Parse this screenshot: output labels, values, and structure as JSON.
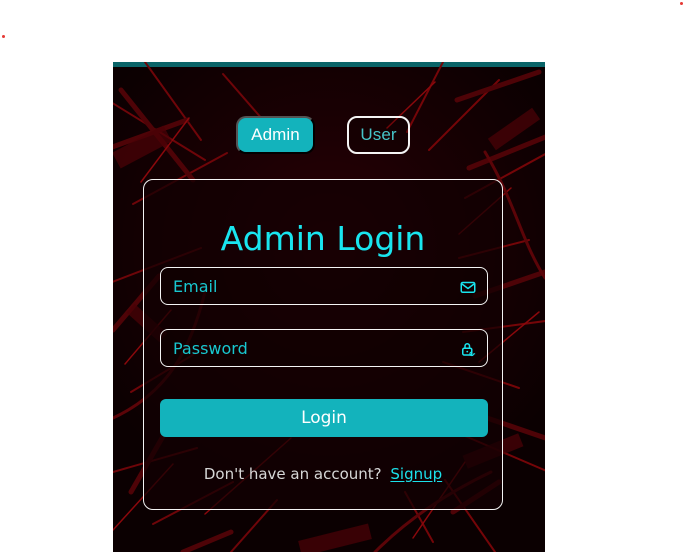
{
  "tabs": {
    "admin": "Admin",
    "user": "User",
    "active": "Admin"
  },
  "card": {
    "title": "Admin Login",
    "email_placeholder": "Email",
    "email_value": "",
    "password_placeholder": "Password",
    "password_value": "",
    "login_label": "Login",
    "signup_prompt": "Don't have an account?",
    "signup_link": "Signup"
  },
  "icons": {
    "email": "mail-icon",
    "password": "lock-icon"
  },
  "colors": {
    "accent": "#13b3bc",
    "title": "#19e5ef",
    "placeholder": "#18c7d0",
    "background": "#1a0003",
    "border": "#f4f4f4"
  }
}
